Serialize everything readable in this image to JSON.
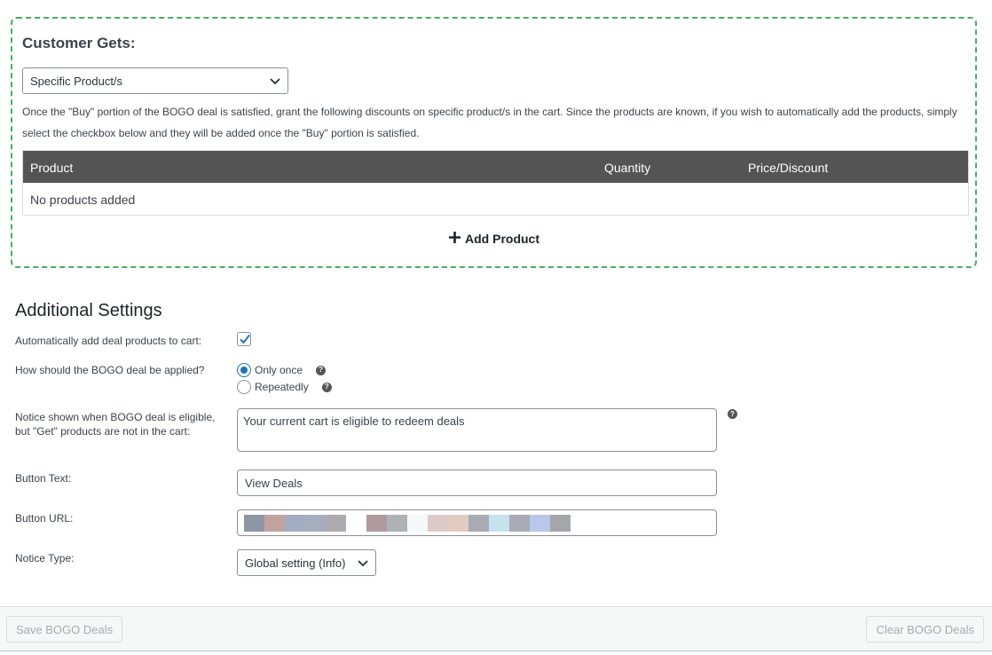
{
  "customer_gets": {
    "title": "Customer Gets:",
    "select_value": "Specific Product/s",
    "description": "Once the \"Buy\" portion of the BOGO deal is satisfied, grant the following discounts on specific product/s in the cart. Since the products are known, if you wish to automatically add the products, simply select the checkbox below and they will be added once the \"Buy\" portion is satisfied.",
    "table": {
      "columns": [
        "Product",
        "Quantity",
        "Price/Discount"
      ],
      "empty_text": "No products added"
    },
    "add_product_label": "Add Product",
    "border_color": "#4aae60"
  },
  "additional_settings": {
    "title": "Additional Settings",
    "auto_add": {
      "label": "Automatically add deal products to cart:",
      "checked": true
    },
    "apply_mode": {
      "label": "How should the BOGO deal be applied?",
      "options": [
        "Only once",
        "Repeatedly"
      ],
      "selected": "Only once"
    },
    "notice": {
      "label": "Notice shown when BOGO deal is eligible, but \"Get\" products are not in the cart:",
      "value": "Your current cart is eligible to redeem deals"
    },
    "button_text": {
      "label": "Button Text:",
      "value": "View Deals"
    },
    "button_url": {
      "label": "Button URL:",
      "redacted_colors": [
        "#8e96a6",
        "#c0a39f",
        "#a2adc3",
        "#a6adbf",
        "#adabb1",
        "#ffffff",
        "#b09a9f",
        "#b0b1b4",
        "#f4f8fb",
        "#ddcac8",
        "#e2cbc1",
        "#a8abb4",
        "#c7e2ef",
        "#a9abb5",
        "#b9c7ea",
        "#a5a6ab"
      ]
    },
    "notice_type": {
      "label": "Notice Type:",
      "value": "Global setting (Info)"
    }
  },
  "footer": {
    "save_label": "Save BOGO Deals",
    "clear_label": "Clear BOGO Deals"
  },
  "icons": {
    "help": "question-circle-icon",
    "add": "plus-icon",
    "dropdown": "chevron-down-icon",
    "check": "checkmark-icon"
  },
  "colors": {
    "table_header_bg": "#545454",
    "accent": "#2271b1"
  }
}
